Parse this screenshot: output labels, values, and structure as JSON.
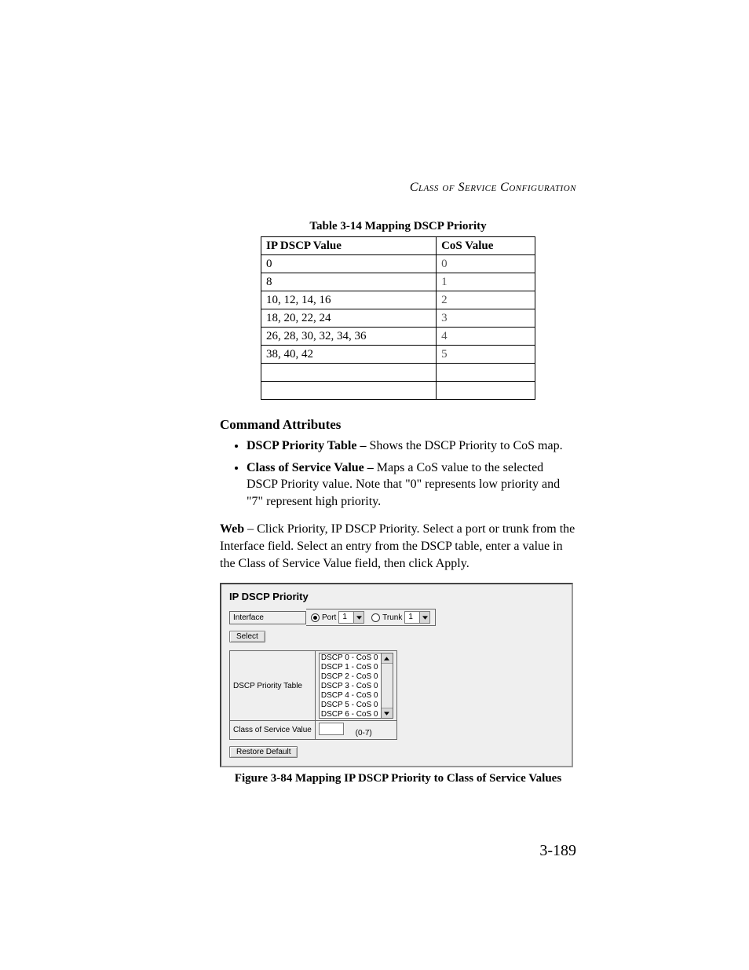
{
  "header": {
    "running_head": "Class of Service Configuration"
  },
  "table": {
    "caption": "Table 3-14  Mapping DSCP Priority",
    "headers": {
      "col1": "IP DSCP Value",
      "col2": "CoS Value"
    },
    "rows": [
      {
        "dscp": "0",
        "cos": "0"
      },
      {
        "dscp": "8",
        "cos": "1"
      },
      {
        "dscp": "10, 12, 14, 16",
        "cos": "2"
      },
      {
        "dscp": "18, 20, 22, 24",
        "cos": "3"
      },
      {
        "dscp": "26, 28, 30, 32, 34, 36",
        "cos": "4"
      },
      {
        "dscp": "38, 40, 42",
        "cos": "5"
      },
      {
        "dscp": "",
        "cos": ""
      },
      {
        "dscp": "",
        "cos": ""
      }
    ]
  },
  "section": {
    "heading": "Command Attributes",
    "bullets": [
      {
        "lead": "DSCP Priority Table – ",
        "text": "Shows the DSCP Priority to CoS map."
      },
      {
        "lead": "Class of Service Value – ",
        "text": "Maps a CoS value to the selected DSCP Priority value. Note that \"0\" represents low priority and \"7\" represent high priority."
      }
    ]
  },
  "web_para": {
    "lead": "Web",
    "text": " – Click Priority, IP DSCP Priority. Select a port or trunk from the Interface field. Select an entry from the DSCP table, enter a value in the Class of Service Value field, then click Apply."
  },
  "ui": {
    "title": "IP DSCP Priority",
    "interface_label": "Interface",
    "port_label": "Port",
    "port_value": "1",
    "trunk_label": "Trunk",
    "trunk_value": "1",
    "select_button": "Select",
    "dscp_table_label": "DSCP Priority Table",
    "listbox_items": [
      "DSCP 0 - CoS 0",
      "DSCP 1 - CoS 0",
      "DSCP 2 - CoS 0",
      "DSCP 3 - CoS 0",
      "DSCP 4 - CoS 0",
      "DSCP 5 - CoS 0",
      "DSCP 6 - CoS 0"
    ],
    "cos_label": "Class of Service Value",
    "cos_range": "(0-7)",
    "restore_button": "Restore Default"
  },
  "figure_caption": "Figure 3-84  Mapping IP DSCP Priority to Class of Service Values",
  "page_number": "3-189"
}
